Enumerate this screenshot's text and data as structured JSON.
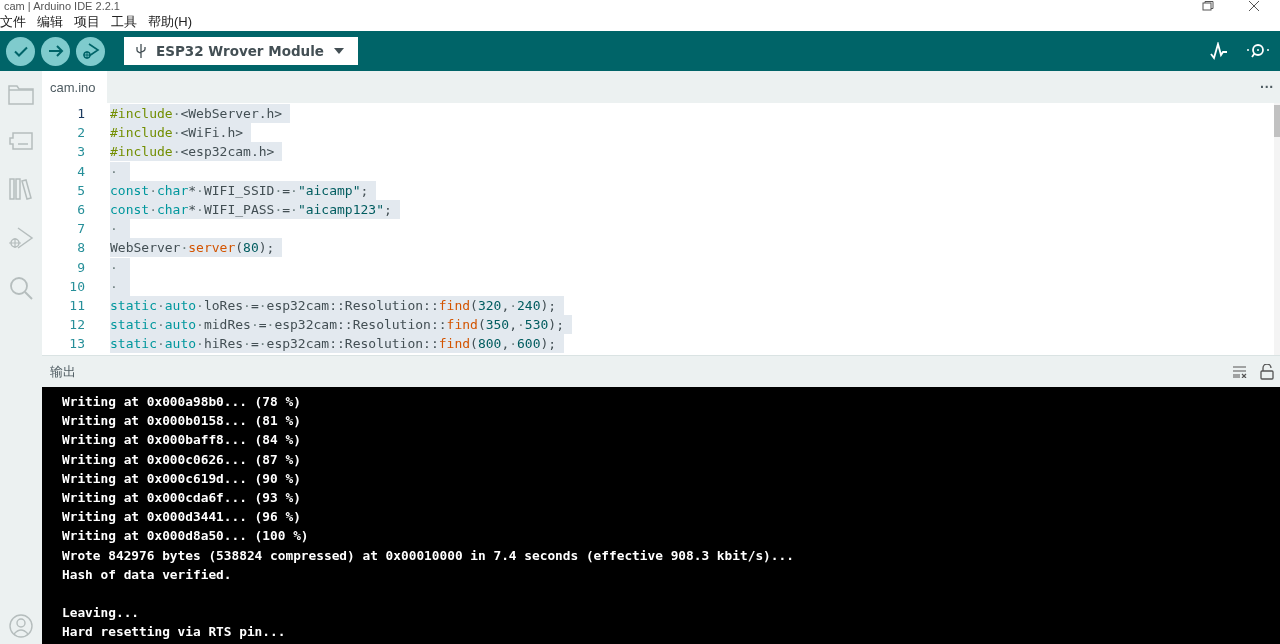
{
  "window": {
    "title": "cam | Arduino IDE 2.2.1"
  },
  "menu": [
    "文件",
    "编辑",
    "项目",
    "工具",
    "帮助(H)"
  ],
  "toolbar": {
    "board": "ESP32 Wrover Module"
  },
  "sidebar": {
    "items": [
      {
        "kind": "folder",
        "selected": false
      },
      {
        "kind": "board",
        "selected": false
      },
      {
        "kind": "library",
        "selected": false
      },
      {
        "kind": "debug",
        "selected": false
      },
      {
        "kind": "search",
        "selected": false
      }
    ]
  },
  "tabs": [
    {
      "label": "cam.ino",
      "selected": true
    }
  ],
  "more": "···",
  "editor": {
    "lines": [
      {
        "number": "1",
        "current": true,
        "selected": true,
        "tokens": [
          {
            "kind": "pp",
            "t": "#include"
          },
          {
            "kind": "ws",
            "t": "·"
          },
          {
            "kind": "plain",
            "t": "<WebServer.h>"
          }
        ]
      },
      {
        "number": "2",
        "current": false,
        "selected": true,
        "tokens": [
          {
            "kind": "pp",
            "t": "#include"
          },
          {
            "kind": "ws",
            "t": "·"
          },
          {
            "kind": "plain",
            "t": "<WiFi.h>"
          }
        ]
      },
      {
        "number": "3",
        "current": false,
        "selected": true,
        "tokens": [
          {
            "kind": "pp",
            "t": "#include"
          },
          {
            "kind": "ws",
            "t": "·"
          },
          {
            "kind": "plain",
            "t": "<esp32cam.h>"
          }
        ]
      },
      {
        "number": "4",
        "current": false,
        "selected": true,
        "tokens": [
          {
            "kind": "ws",
            "t": "·"
          }
        ]
      },
      {
        "number": "5",
        "current": false,
        "selected": true,
        "tokens": [
          {
            "kind": "kw",
            "t": "const"
          },
          {
            "kind": "ws",
            "t": "·"
          },
          {
            "kind": "kw",
            "t": "char"
          },
          {
            "kind": "plain",
            "t": "*"
          },
          {
            "kind": "ws",
            "t": "·"
          },
          {
            "kind": "plain",
            "t": "WIFI_SSID"
          },
          {
            "kind": "ws",
            "t": "·"
          },
          {
            "kind": "plain",
            "t": "="
          },
          {
            "kind": "ws",
            "t": "·"
          },
          {
            "kind": "str",
            "t": "\"aicamp\""
          },
          {
            "kind": "plain",
            "t": ";"
          }
        ]
      },
      {
        "number": "6",
        "current": false,
        "selected": true,
        "tokens": [
          {
            "kind": "kw",
            "t": "const"
          },
          {
            "kind": "ws",
            "t": "·"
          },
          {
            "kind": "kw",
            "t": "char"
          },
          {
            "kind": "plain",
            "t": "*"
          },
          {
            "kind": "ws",
            "t": "·"
          },
          {
            "kind": "plain",
            "t": "WIFI_PASS"
          },
          {
            "kind": "ws",
            "t": "·"
          },
          {
            "kind": "plain",
            "t": "="
          },
          {
            "kind": "ws",
            "t": "·"
          },
          {
            "kind": "str",
            "t": "\"aicamp123\""
          },
          {
            "kind": "plain",
            "t": ";"
          }
        ]
      },
      {
        "number": "7",
        "current": false,
        "selected": true,
        "tokens": [
          {
            "kind": "ws",
            "t": "·"
          }
        ]
      },
      {
        "number": "8",
        "current": false,
        "selected": true,
        "tokens": [
          {
            "kind": "plain",
            "t": "WebServer"
          },
          {
            "kind": "ws",
            "t": "·"
          },
          {
            "kind": "fn",
            "t": "server"
          },
          {
            "kind": "plain",
            "t": "("
          },
          {
            "kind": "num",
            "t": "80"
          },
          {
            "kind": "plain",
            "t": ");"
          }
        ]
      },
      {
        "number": "9",
        "current": false,
        "selected": true,
        "tokens": [
          {
            "kind": "ws",
            "t": "·"
          }
        ]
      },
      {
        "number": "10",
        "current": false,
        "selected": true,
        "tokens": [
          {
            "kind": "ws",
            "t": "·"
          }
        ]
      },
      {
        "number": "11",
        "current": false,
        "selected": true,
        "tokens": [
          {
            "kind": "kw",
            "t": "static"
          },
          {
            "kind": "ws",
            "t": "·"
          },
          {
            "kind": "kw",
            "t": "auto"
          },
          {
            "kind": "ws",
            "t": "·"
          },
          {
            "kind": "plain",
            "t": "loRes"
          },
          {
            "kind": "ws",
            "t": "·"
          },
          {
            "kind": "plain",
            "t": "="
          },
          {
            "kind": "ws",
            "t": "·"
          },
          {
            "kind": "plain",
            "t": "esp32cam::Resolution::"
          },
          {
            "kind": "fn",
            "t": "find"
          },
          {
            "kind": "plain",
            "t": "("
          },
          {
            "kind": "num",
            "t": "320"
          },
          {
            "kind": "plain",
            "t": ","
          },
          {
            "kind": "ws",
            "t": "·"
          },
          {
            "kind": "num",
            "t": "240"
          },
          {
            "kind": "plain",
            "t": ");"
          }
        ]
      },
      {
        "number": "12",
        "current": false,
        "selected": true,
        "tokens": [
          {
            "kind": "kw",
            "t": "static"
          },
          {
            "kind": "ws",
            "t": "·"
          },
          {
            "kind": "kw",
            "t": "auto"
          },
          {
            "kind": "ws",
            "t": "·"
          },
          {
            "kind": "plain",
            "t": "midRes"
          },
          {
            "kind": "ws",
            "t": "·"
          },
          {
            "kind": "plain",
            "t": "="
          },
          {
            "kind": "ws",
            "t": "·"
          },
          {
            "kind": "plain",
            "t": "esp32cam::Resolution::"
          },
          {
            "kind": "fn",
            "t": "find"
          },
          {
            "kind": "plain",
            "t": "("
          },
          {
            "kind": "num",
            "t": "350"
          },
          {
            "kind": "plain",
            "t": ","
          },
          {
            "kind": "ws",
            "t": "·"
          },
          {
            "kind": "num",
            "t": "530"
          },
          {
            "kind": "plain",
            "t": ");"
          }
        ]
      },
      {
        "number": "13",
        "current": false,
        "selected": true,
        "tokens": [
          {
            "kind": "kw",
            "t": "static"
          },
          {
            "kind": "ws",
            "t": "·"
          },
          {
            "kind": "kw",
            "t": "auto"
          },
          {
            "kind": "ws",
            "t": "·"
          },
          {
            "kind": "plain",
            "t": "hiRes"
          },
          {
            "kind": "ws",
            "t": "·"
          },
          {
            "kind": "plain",
            "t": "="
          },
          {
            "kind": "ws",
            "t": "·"
          },
          {
            "kind": "plain",
            "t": "esp32cam::Resolution::"
          },
          {
            "kind": "fn",
            "t": "find"
          },
          {
            "kind": "plain",
            "t": "("
          },
          {
            "kind": "num",
            "t": "800"
          },
          {
            "kind": "plain",
            "t": ","
          },
          {
            "kind": "ws",
            "t": "·"
          },
          {
            "kind": "num",
            "t": "600"
          },
          {
            "kind": "plain",
            "t": ");"
          }
        ]
      }
    ]
  },
  "output": {
    "title": "输出",
    "blocks": [
      [
        "Writing at 0x000a98b0... (78 %)",
        "Writing at 0x000b0158... (81 %)",
        "Writing at 0x000baff8... (84 %)",
        "Writing at 0x000c0626... (87 %)",
        "Writing at 0x000c619d... (90 %)",
        "Writing at 0x000cda6f... (93 %)",
        "Writing at 0x000d3441... (96 %)",
        "Writing at 0x000d8a50... (100 %)",
        "Wrote 842976 bytes (538824 compressed) at 0x00010000 in 7.4 seconds (effective 908.3 kbit/s)...",
        "Hash of data verified."
      ],
      [
        "Leaving...",
        "Hard resetting via RTS pin..."
      ]
    ]
  }
}
